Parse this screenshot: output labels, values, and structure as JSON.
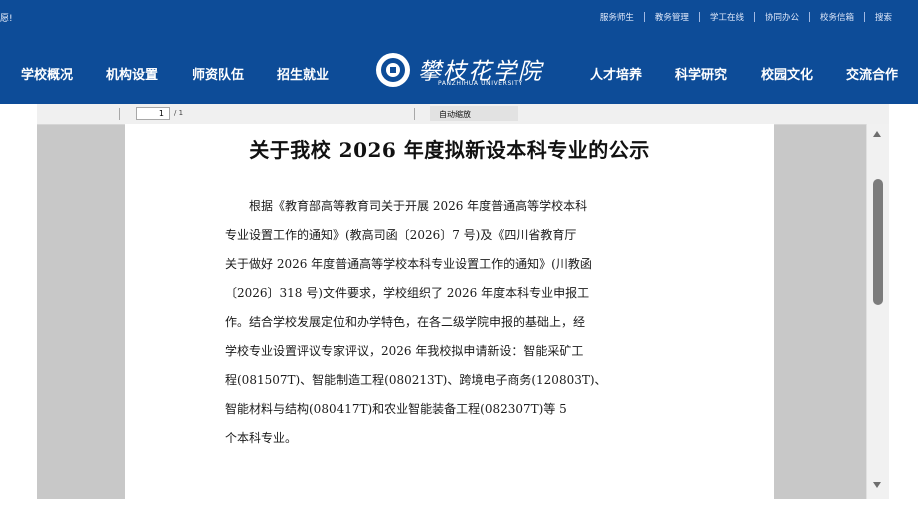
{
  "header": {
    "top_left_text": "愿!",
    "top_links": [
      "服务师生",
      "教务管理",
      "学工在线",
      "协同办公",
      "校务信箱",
      "搜索"
    ],
    "nav_left": [
      "学校概况",
      "机构设置",
      "师资队伍",
      "招生就业"
    ],
    "nav_right": [
      "人才培养",
      "科学研究",
      "校园文化",
      "交流合作"
    ],
    "logo_name": "攀枝花学院",
    "logo_en": "PANZHIHUA UNIVERSITY",
    "bg_color": "#0d4c98"
  },
  "viewer": {
    "page_number": "1",
    "page_count": "/ 1",
    "zoom": "自动缩放",
    "document": {
      "title": "关于我校 2026 年度拟新设本科专业的公示",
      "lines": [
        "　　根据《教育部高等教育司关于开展 2026 年度普通高等学校本科",
        "专业设置工作的通知》(教高司函〔2026〕7 号)及《四川省教育厅",
        "关于做好 2026 年度普通高等学校本科专业设置工作的通知》(川教函",
        "〔2026〕318 号)文件要求，学校组织了 2026 年度本科专业申报工",
        "作。结合学校发展定位和办学特色，在各二级学院申报的基础上，经",
        "学校专业设置评议专家评议，2026 年我校拟申请新设：智能采矿工",
        "程(081507T)、智能制造工程(080213T)、跨境电子商务(120803T)、",
        "智能材料与结构(080417T)和农业智能装备工程(082307T)等 5",
        "个本科专业。"
      ]
    }
  }
}
